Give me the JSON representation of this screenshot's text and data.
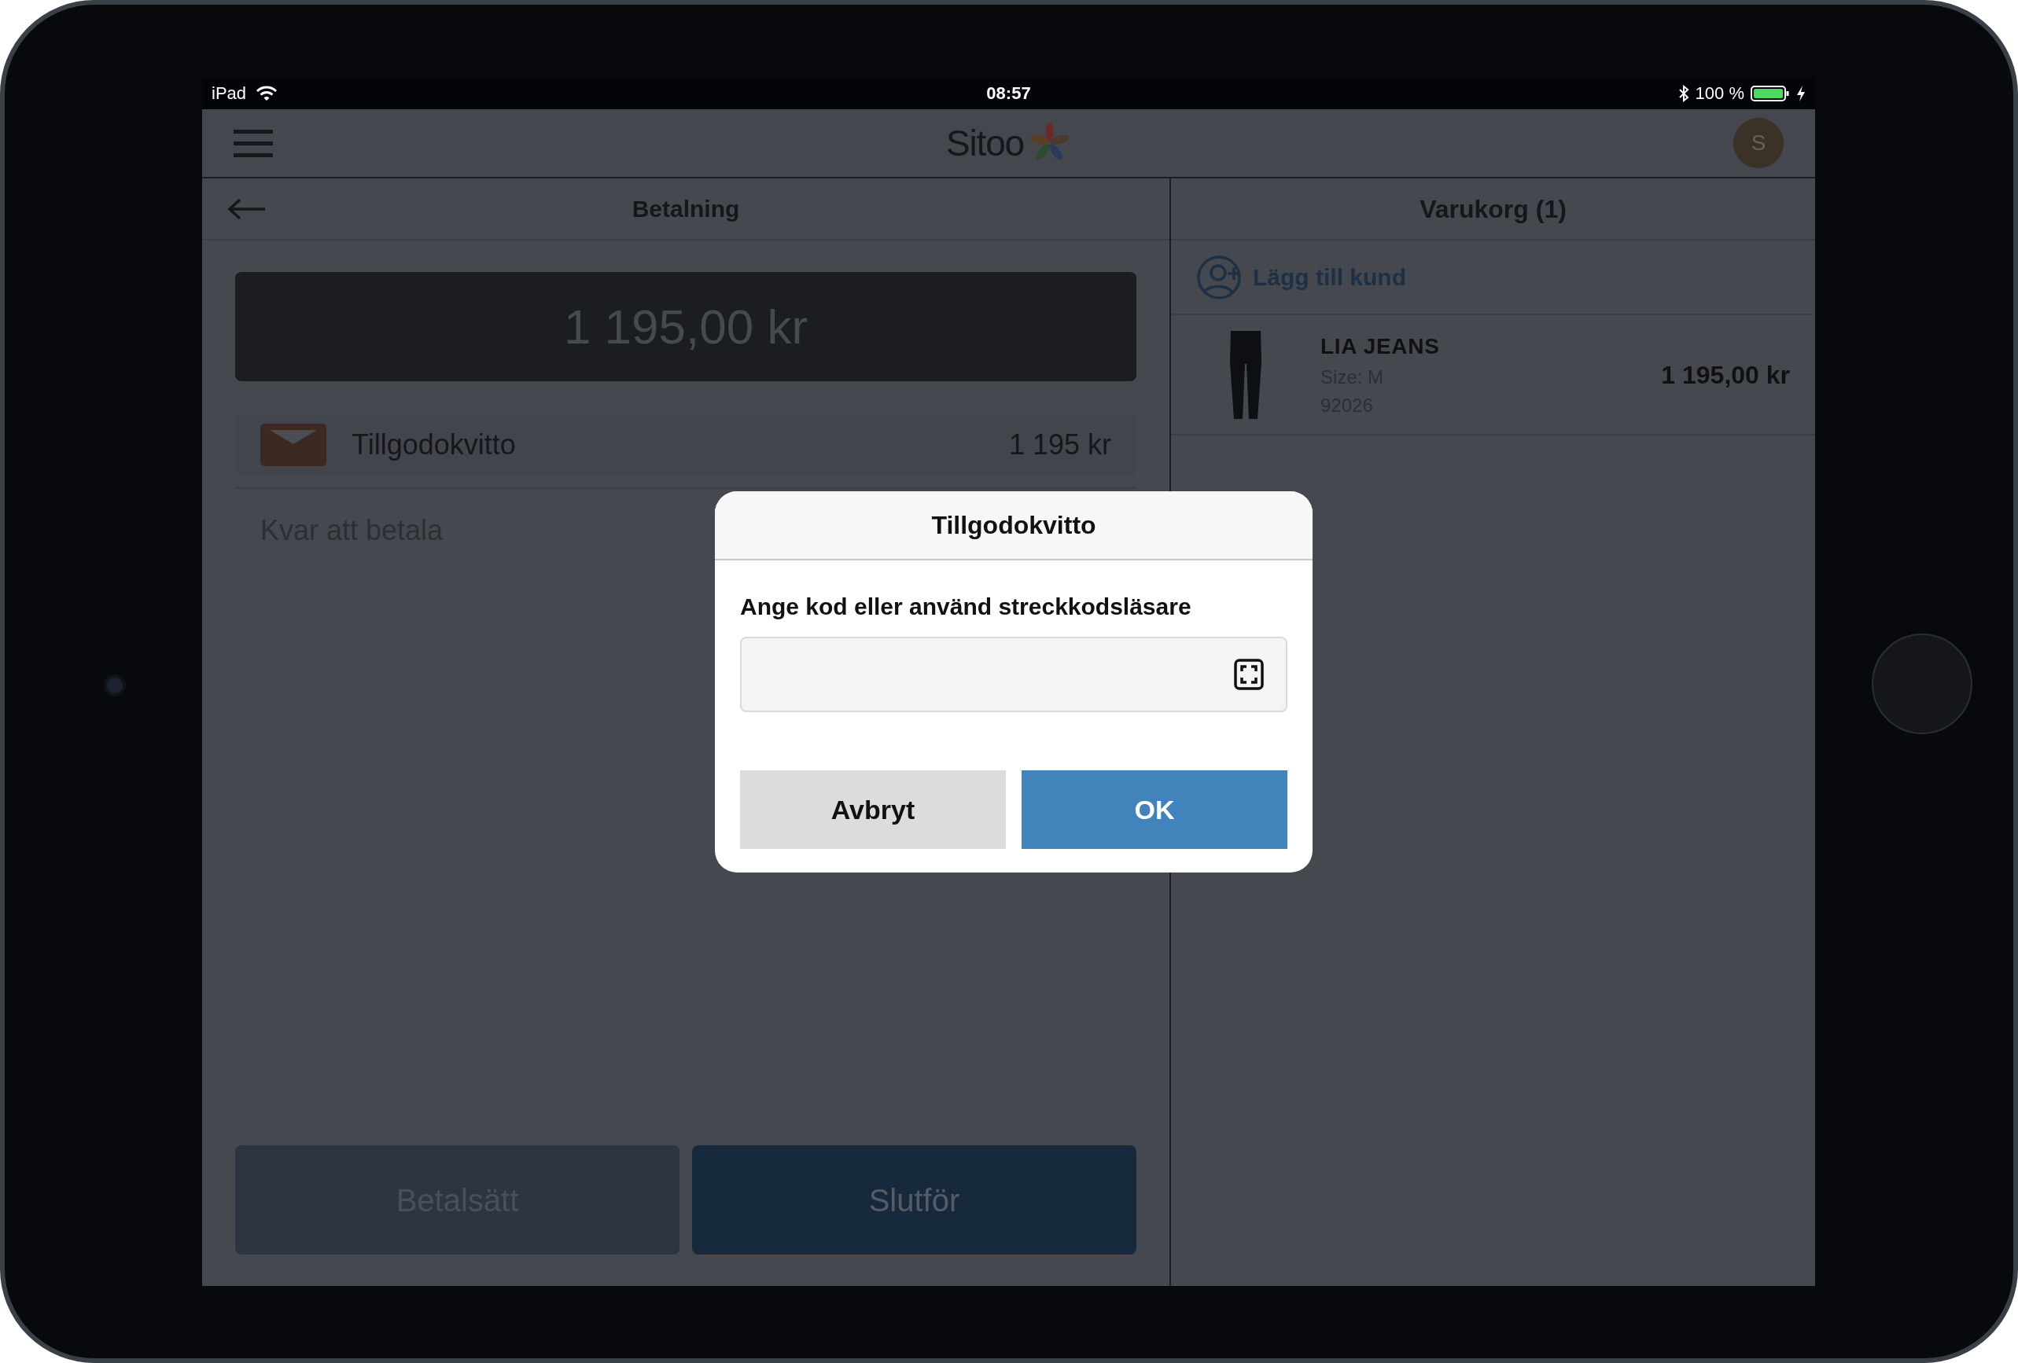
{
  "status_bar": {
    "device": "iPad",
    "time": "08:57",
    "battery": "100 %"
  },
  "header": {
    "logo": "Sitoo",
    "avatar": "S"
  },
  "payment": {
    "title": "Betalning",
    "amount": "1 195,00 kr",
    "tenders": [
      {
        "label": "Tillgodokvitto",
        "amount": "1 195 kr"
      }
    ],
    "remaining_label": "Kvar att betala",
    "buttons": [
      {
        "label": "Betalsätt",
        "kind": "secondary"
      },
      {
        "label": "Slutför",
        "kind": "primary"
      }
    ]
  },
  "cart": {
    "title": "Varukorg (1)",
    "add_customer": "Lägg till kund",
    "items": [
      {
        "name": "LIA JEANS",
        "size": "Size: M",
        "sku": "92026",
        "price": "1 195,00 kr"
      }
    ]
  },
  "dialog": {
    "title": "Tillgodokvitto",
    "prompt": "Ange kod eller använd streckkodsläsare",
    "buttons": [
      {
        "label": "Avbryt",
        "kind": "cancel"
      },
      {
        "label": "OK",
        "kind": "primary"
      }
    ]
  }
}
